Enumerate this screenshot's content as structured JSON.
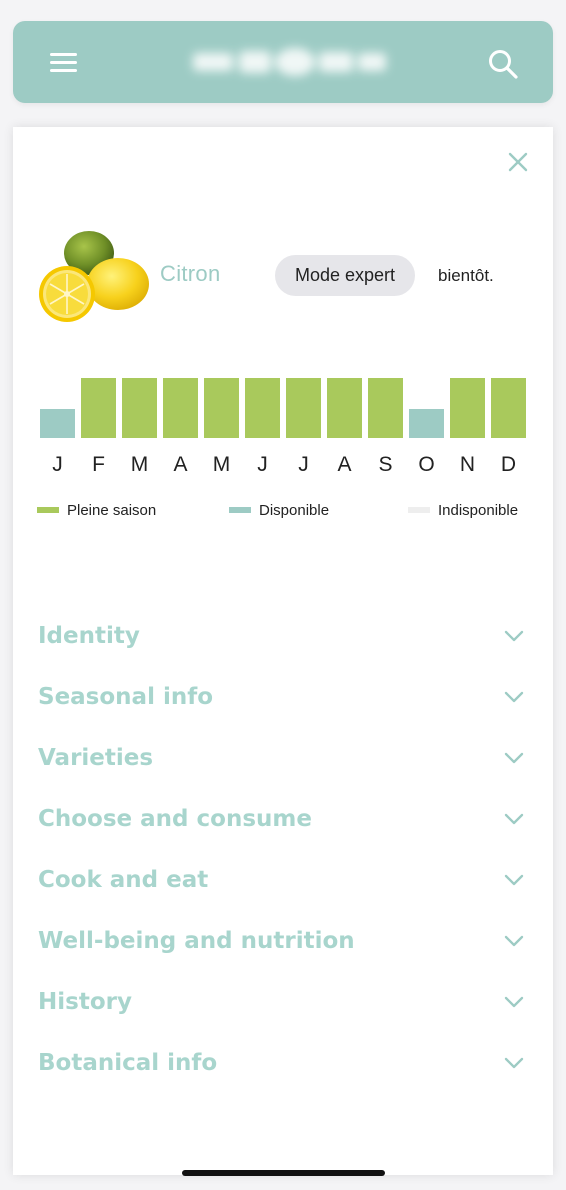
{
  "header": {
    "menu_icon": "hamburger-menu-icon",
    "logo_label": "PRODUCE",
    "search_icon": "search-icon",
    "background_color": "#9dcbc4"
  },
  "product": {
    "name": "Citron",
    "image_icon": "lemon-lime-image",
    "expert_mode_label": "Mode expert",
    "soon_text": "bientôt.",
    "close_icon": "close-icon"
  },
  "season": {
    "months": [
      "J",
      "F",
      "M",
      "A",
      "M",
      "J",
      "J",
      "A",
      "S",
      "O",
      "N",
      "D"
    ],
    "status": [
      "disponible",
      "pleine",
      "pleine",
      "pleine",
      "pleine",
      "pleine",
      "pleine",
      "pleine",
      "pleine",
      "disponible",
      "pleine",
      "pleine"
    ],
    "colors": {
      "pleine": "#a9c95c",
      "disponible": "#9dcbc4",
      "indisponible": "#eeeeee"
    },
    "legend": [
      {
        "key": "pleine",
        "label": "Pleine saison"
      },
      {
        "key": "disponible",
        "label": "Disponible"
      },
      {
        "key": "indisponible",
        "label": "Indisponible"
      }
    ]
  },
  "sections": [
    {
      "label": "Identity",
      "icon": "chevron-down-icon"
    },
    {
      "label": "Seasonal info",
      "icon": "chevron-down-icon"
    },
    {
      "label": "Varieties",
      "icon": "chevron-down-icon"
    },
    {
      "label": "Choose and consume",
      "icon": "chevron-down-icon"
    },
    {
      "label": "Cook and eat",
      "icon": "chevron-down-icon"
    },
    {
      "label": "Well-being and nutrition",
      "icon": "chevron-down-icon"
    },
    {
      "label": "History",
      "icon": "chevron-down-icon"
    },
    {
      "label": "Botanical info",
      "icon": "chevron-down-icon"
    }
  ],
  "accent_color": "#a8d5cd"
}
